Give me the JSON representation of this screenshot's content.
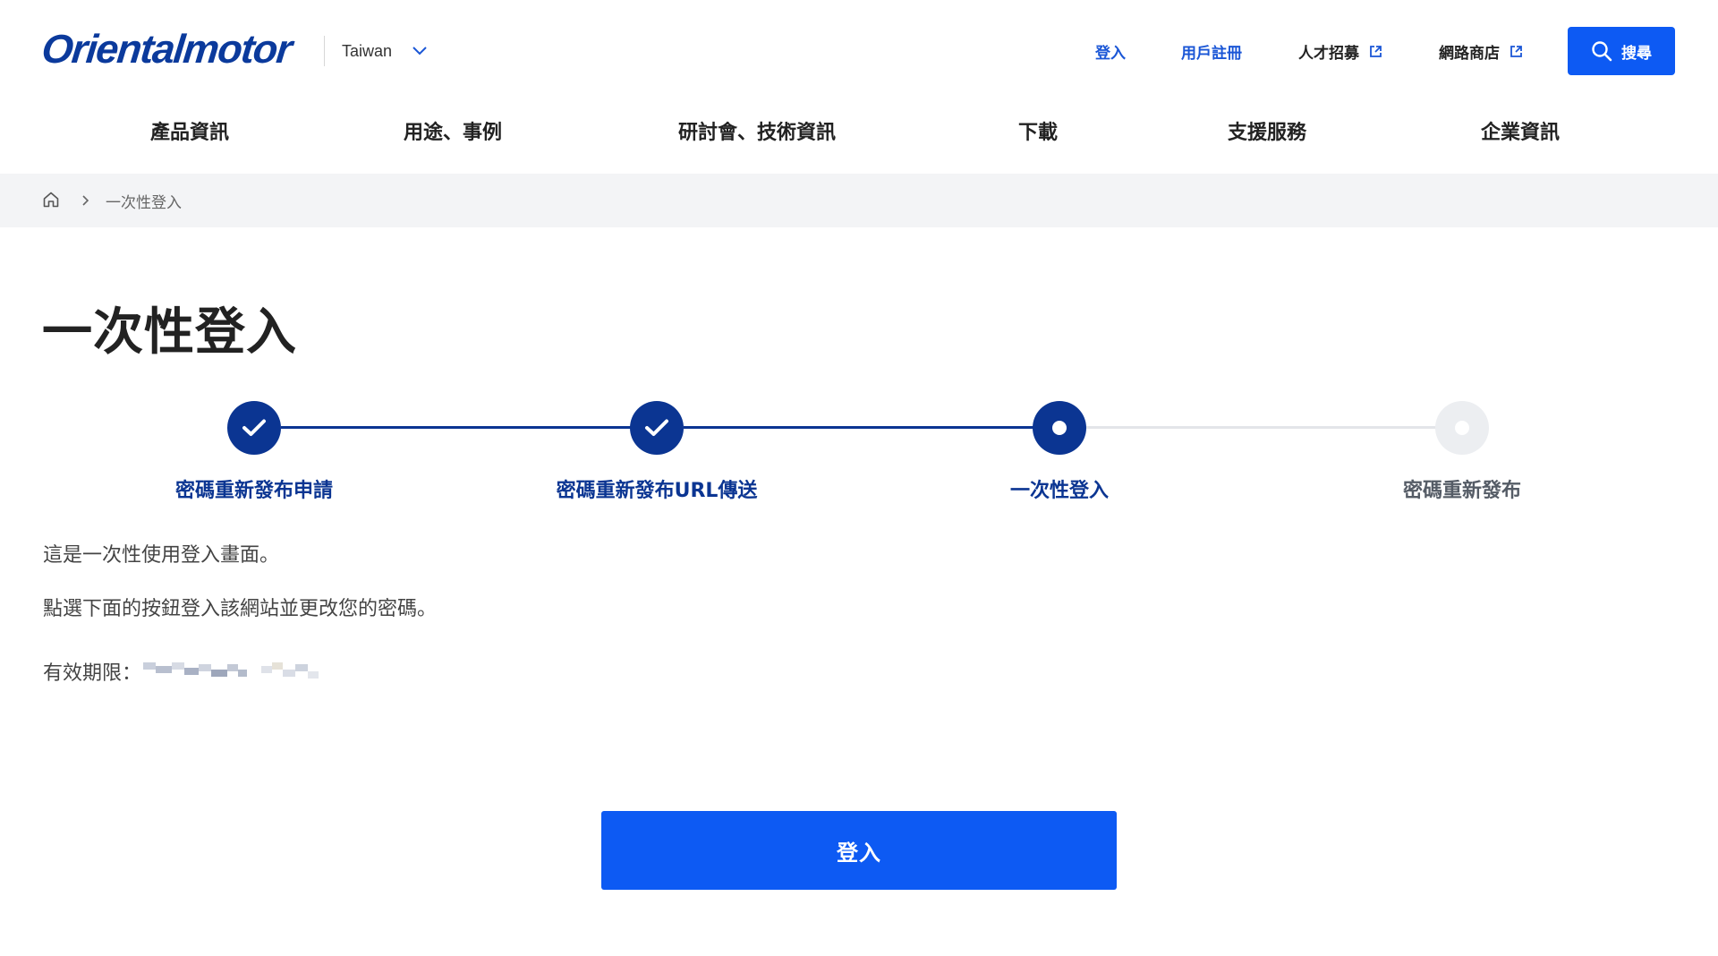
{
  "header": {
    "logo": "Orientalmotor",
    "country": "Taiwan",
    "links": {
      "login": "登入",
      "register": "用戶註冊",
      "careers": "人才招募",
      "shop": "網路商店"
    },
    "search_label": "搜尋"
  },
  "nav": {
    "items": [
      "產品資訊",
      "用途、事例",
      "研討會、技術資訊",
      "下載",
      "支援服務",
      "企業資訊"
    ]
  },
  "breadcrumb": {
    "current": "一次性登入"
  },
  "page": {
    "title": "一次性登入"
  },
  "steps": [
    {
      "label": "密碼重新發布申請",
      "state": "done"
    },
    {
      "label": "密碼重新發布URL傳送",
      "state": "done"
    },
    {
      "label": "一次性登入",
      "state": "current"
    },
    {
      "label": "密碼重新發布",
      "state": "todo"
    }
  ],
  "content": {
    "line1": "這是一次性使用登入畫面。",
    "line2": "點選下面的按鈕登入該網站並更改您的密碼。",
    "expiry_label": "有效期限："
  },
  "actions": {
    "login_button": "登入"
  },
  "colors": {
    "brand_blue": "#0d5af3",
    "navy": "#0b3592",
    "link_blue": "#1a56d6",
    "breadcrumb_bg": "#f3f4f6"
  }
}
